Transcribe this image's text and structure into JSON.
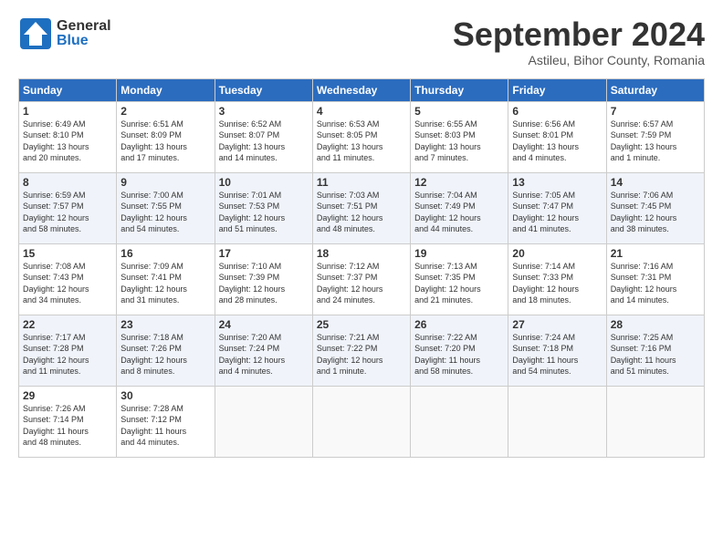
{
  "header": {
    "logo_general": "General",
    "logo_blue": "Blue",
    "month_title": "September 2024",
    "location": "Astileu, Bihor County, Romania"
  },
  "days_of_week": [
    "Sunday",
    "Monday",
    "Tuesday",
    "Wednesday",
    "Thursday",
    "Friday",
    "Saturday"
  ],
  "weeks": [
    [
      {
        "day": "1",
        "info": "Sunrise: 6:49 AM\nSunset: 8:10 PM\nDaylight: 13 hours\nand 20 minutes."
      },
      {
        "day": "2",
        "info": "Sunrise: 6:51 AM\nSunset: 8:09 PM\nDaylight: 13 hours\nand 17 minutes."
      },
      {
        "day": "3",
        "info": "Sunrise: 6:52 AM\nSunset: 8:07 PM\nDaylight: 13 hours\nand 14 minutes."
      },
      {
        "day": "4",
        "info": "Sunrise: 6:53 AM\nSunset: 8:05 PM\nDaylight: 13 hours\nand 11 minutes."
      },
      {
        "day": "5",
        "info": "Sunrise: 6:55 AM\nSunset: 8:03 PM\nDaylight: 13 hours\nand 7 minutes."
      },
      {
        "day": "6",
        "info": "Sunrise: 6:56 AM\nSunset: 8:01 PM\nDaylight: 13 hours\nand 4 minutes."
      },
      {
        "day": "7",
        "info": "Sunrise: 6:57 AM\nSunset: 7:59 PM\nDaylight: 13 hours\nand 1 minute."
      }
    ],
    [
      {
        "day": "8",
        "info": "Sunrise: 6:59 AM\nSunset: 7:57 PM\nDaylight: 12 hours\nand 58 minutes."
      },
      {
        "day": "9",
        "info": "Sunrise: 7:00 AM\nSunset: 7:55 PM\nDaylight: 12 hours\nand 54 minutes."
      },
      {
        "day": "10",
        "info": "Sunrise: 7:01 AM\nSunset: 7:53 PM\nDaylight: 12 hours\nand 51 minutes."
      },
      {
        "day": "11",
        "info": "Sunrise: 7:03 AM\nSunset: 7:51 PM\nDaylight: 12 hours\nand 48 minutes."
      },
      {
        "day": "12",
        "info": "Sunrise: 7:04 AM\nSunset: 7:49 PM\nDaylight: 12 hours\nand 44 minutes."
      },
      {
        "day": "13",
        "info": "Sunrise: 7:05 AM\nSunset: 7:47 PM\nDaylight: 12 hours\nand 41 minutes."
      },
      {
        "day": "14",
        "info": "Sunrise: 7:06 AM\nSunset: 7:45 PM\nDaylight: 12 hours\nand 38 minutes."
      }
    ],
    [
      {
        "day": "15",
        "info": "Sunrise: 7:08 AM\nSunset: 7:43 PM\nDaylight: 12 hours\nand 34 minutes."
      },
      {
        "day": "16",
        "info": "Sunrise: 7:09 AM\nSunset: 7:41 PM\nDaylight: 12 hours\nand 31 minutes."
      },
      {
        "day": "17",
        "info": "Sunrise: 7:10 AM\nSunset: 7:39 PM\nDaylight: 12 hours\nand 28 minutes."
      },
      {
        "day": "18",
        "info": "Sunrise: 7:12 AM\nSunset: 7:37 PM\nDaylight: 12 hours\nand 24 minutes."
      },
      {
        "day": "19",
        "info": "Sunrise: 7:13 AM\nSunset: 7:35 PM\nDaylight: 12 hours\nand 21 minutes."
      },
      {
        "day": "20",
        "info": "Sunrise: 7:14 AM\nSunset: 7:33 PM\nDaylight: 12 hours\nand 18 minutes."
      },
      {
        "day": "21",
        "info": "Sunrise: 7:16 AM\nSunset: 7:31 PM\nDaylight: 12 hours\nand 14 minutes."
      }
    ],
    [
      {
        "day": "22",
        "info": "Sunrise: 7:17 AM\nSunset: 7:28 PM\nDaylight: 12 hours\nand 11 minutes."
      },
      {
        "day": "23",
        "info": "Sunrise: 7:18 AM\nSunset: 7:26 PM\nDaylight: 12 hours\nand 8 minutes."
      },
      {
        "day": "24",
        "info": "Sunrise: 7:20 AM\nSunset: 7:24 PM\nDaylight: 12 hours\nand 4 minutes."
      },
      {
        "day": "25",
        "info": "Sunrise: 7:21 AM\nSunset: 7:22 PM\nDaylight: 12 hours\nand 1 minute."
      },
      {
        "day": "26",
        "info": "Sunrise: 7:22 AM\nSunset: 7:20 PM\nDaylight: 11 hours\nand 58 minutes."
      },
      {
        "day": "27",
        "info": "Sunrise: 7:24 AM\nSunset: 7:18 PM\nDaylight: 11 hours\nand 54 minutes."
      },
      {
        "day": "28",
        "info": "Sunrise: 7:25 AM\nSunset: 7:16 PM\nDaylight: 11 hours\nand 51 minutes."
      }
    ],
    [
      {
        "day": "29",
        "info": "Sunrise: 7:26 AM\nSunset: 7:14 PM\nDaylight: 11 hours\nand 48 minutes."
      },
      {
        "day": "30",
        "info": "Sunrise: 7:28 AM\nSunset: 7:12 PM\nDaylight: 11 hours\nand 44 minutes."
      },
      {
        "day": "",
        "info": ""
      },
      {
        "day": "",
        "info": ""
      },
      {
        "day": "",
        "info": ""
      },
      {
        "day": "",
        "info": ""
      },
      {
        "day": "",
        "info": ""
      }
    ]
  ]
}
